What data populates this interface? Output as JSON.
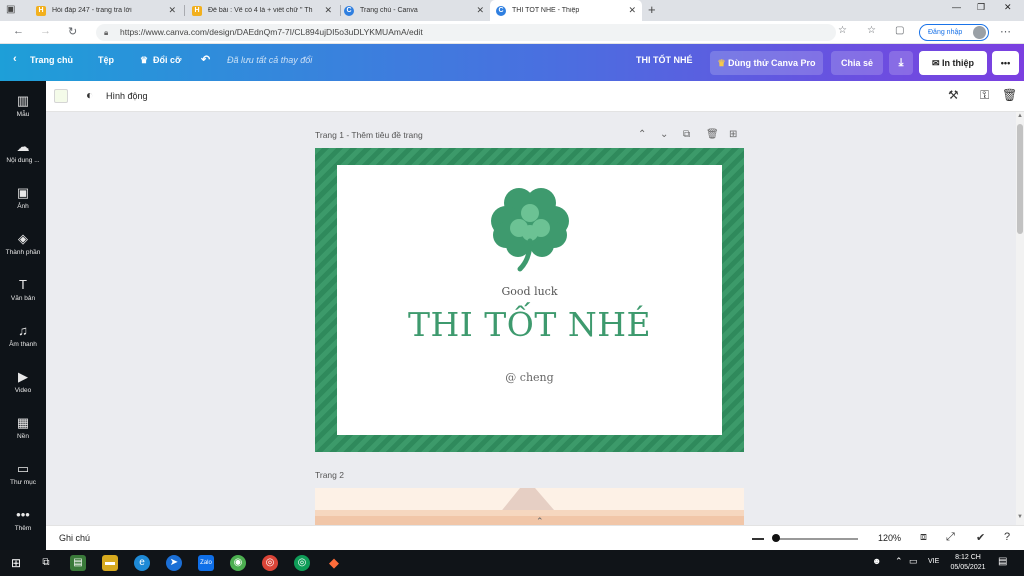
{
  "browser": {
    "tabs": [
      {
        "title": "Hỏi đáp 247 - trang tra lời",
        "active": false,
        "favicon": "H"
      },
      {
        "title": "Đề bài : Vẽ cỏ 4 lá + viết chữ \" Th",
        "active": false,
        "favicon": "H"
      },
      {
        "title": "Trang chủ - Canva",
        "active": false,
        "favicon": "C"
      },
      {
        "title": "THI TỐT NHÉ - Thiệp",
        "active": true,
        "favicon": "C"
      }
    ],
    "url": "https://www.canva.com/design/DAEdnQm7-7I/CL894ujDI5o3uDLYKMUAmA/edit",
    "login_label": "Đăng nhập"
  },
  "canva_header": {
    "home_label": "Trang chủ",
    "file_label": "Tệp",
    "resize_label": "Đổi cỡ",
    "saved_status": "Đã lưu tất cả thay đổi",
    "design_title": "THI TỐT NHÉ",
    "try_pro_label": "Dùng thử Canva Pro",
    "share_label": "Chia sẻ",
    "print_label": "In thiệp"
  },
  "sidebar": {
    "items": [
      {
        "label": "Mẫu",
        "icon": "template-icon",
        "glyph": "▥"
      },
      {
        "label": "Nội dung ...",
        "icon": "upload-icon",
        "glyph": "☁"
      },
      {
        "label": "Ảnh",
        "icon": "photo-icon",
        "glyph": "▣"
      },
      {
        "label": "Thành phần",
        "icon": "elements-icon",
        "glyph": "◈"
      },
      {
        "label": "Văn bản",
        "icon": "text-icon",
        "glyph": "T"
      },
      {
        "label": "Âm thanh",
        "icon": "music-icon",
        "glyph": "♫"
      },
      {
        "label": "Video",
        "icon": "video-icon",
        "glyph": "▶"
      },
      {
        "label": "Nền",
        "icon": "background-icon",
        "glyph": "▦"
      },
      {
        "label": "Thư mục",
        "icon": "folder-icon",
        "glyph": "▭"
      },
      {
        "label": "Thêm",
        "icon": "more-icon",
        "glyph": "•••"
      }
    ]
  },
  "toolbar": {
    "animation_label": "Hình động"
  },
  "canvas": {
    "page1_label": "Trang 1",
    "page1_subtitle": " - Thêm tiêu đề trang",
    "page2_label": "Trang 2",
    "card": {
      "subtitle": "Good luck",
      "title": "THI TỐT NHÉ",
      "author": "@ cheng"
    }
  },
  "bottombar": {
    "notes_label": "Ghi chú",
    "zoom": "120%"
  },
  "taskbar": {
    "language": "VIE",
    "time": "8:12 CH",
    "date": "05/05/2021"
  },
  "colors": {
    "accent_green": "#3e9a6e",
    "header_start": "#1e9fd8",
    "header_end": "#7b3fe0",
    "sidebar_bg": "#0e1318"
  }
}
